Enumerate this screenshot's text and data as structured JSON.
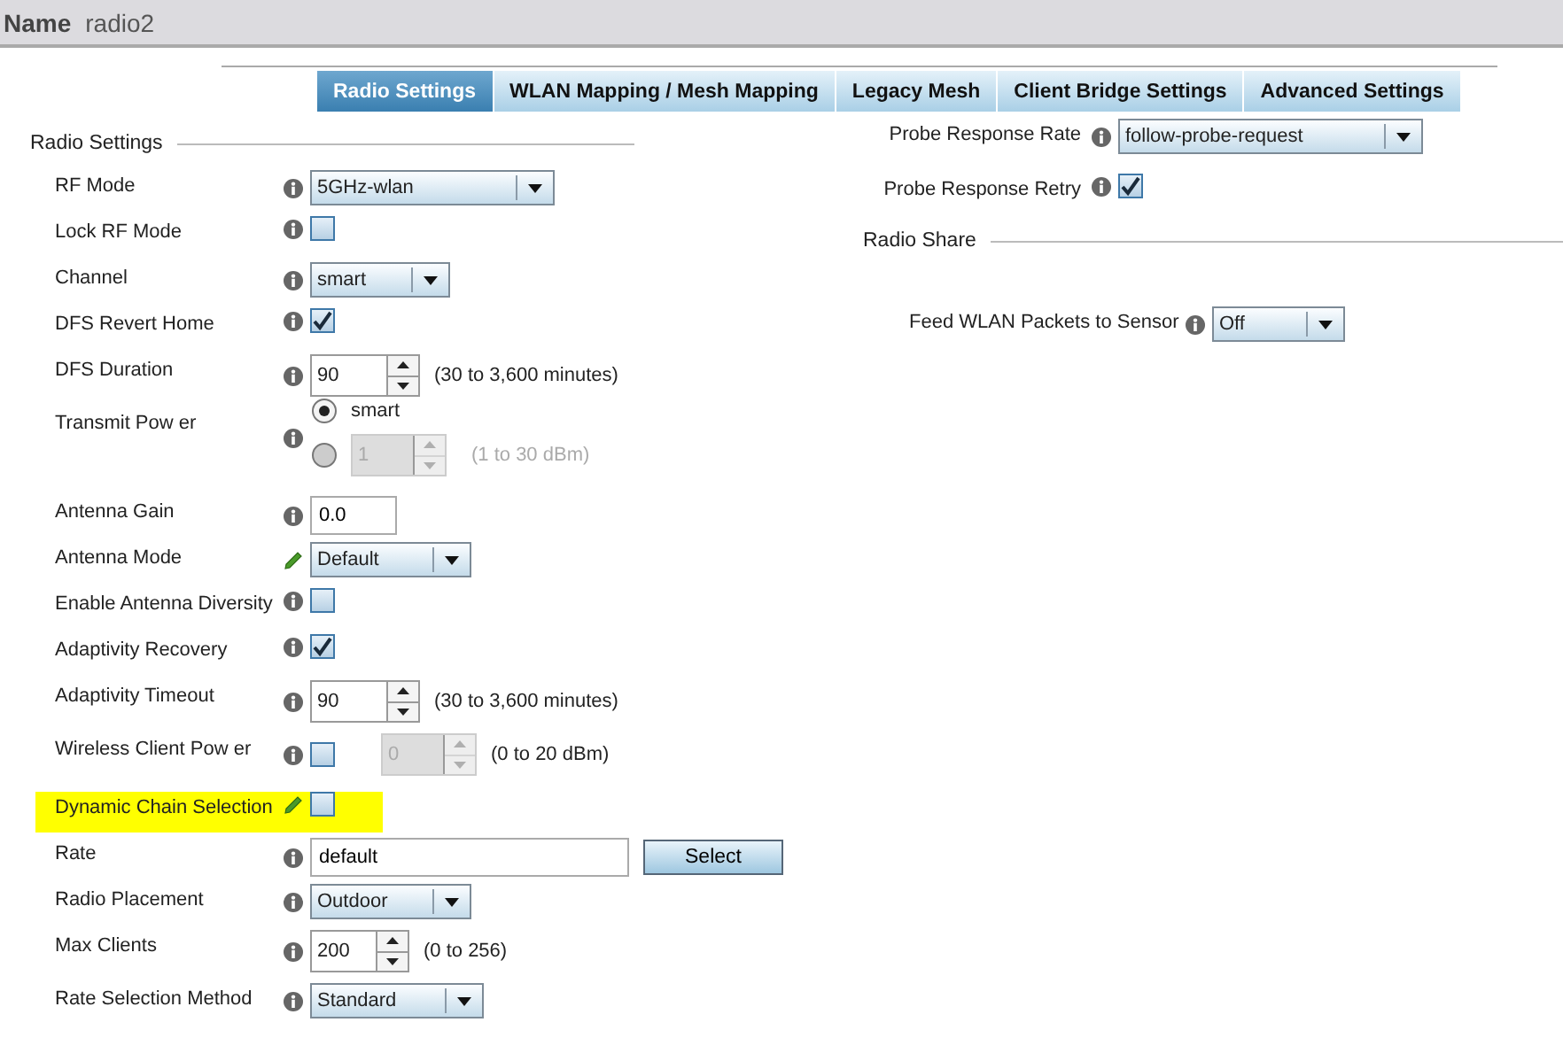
{
  "header": {
    "label": "Name",
    "value": "radio2"
  },
  "tabs": [
    {
      "label": "Radio Settings",
      "selected": true
    },
    {
      "label": "WLAN Mapping / Mesh Mapping",
      "selected": false
    },
    {
      "label": "Legacy Mesh",
      "selected": false
    },
    {
      "label": "Client Bridge Settings",
      "selected": false
    },
    {
      "label": "Advanced Settings",
      "selected": false
    }
  ],
  "radio_settings": {
    "title": "Radio Settings",
    "rows": [
      {
        "label": "RF Mode",
        "overridden": false,
        "kind": "select",
        "value": "5GHz-wlan"
      },
      {
        "label": "Lock RF Mode",
        "overridden": false,
        "kind": "checkbox",
        "checked": false
      },
      {
        "label": "Channel",
        "overridden": false,
        "kind": "select",
        "value": "smart"
      },
      {
        "label": "DFS Revert Home",
        "overridden": false,
        "kind": "checkbox",
        "checked": true
      },
      {
        "label": "DFS Duration",
        "overridden": false,
        "kind": "spinner",
        "value": "90",
        "hint": "(30 to 3,600 minutes)",
        "disabled": false
      },
      {
        "label": "Transmit Pow er",
        "overridden": false,
        "kind": "radios",
        "options": [
          {
            "kind": "radio",
            "label": "smart",
            "selected": true
          },
          {
            "kind": "radio-spinner",
            "value": "1",
            "hint": "(1 to 30 dBm)",
            "selected": false
          }
        ]
      },
      {
        "label": "Antenna Gain",
        "overridden": false,
        "kind": "text",
        "value": "0.0"
      },
      {
        "label": "Antenna Mode",
        "overridden": true,
        "kind": "select",
        "value": "Default"
      },
      {
        "label": "Enable Antenna Diversity",
        "overridden": false,
        "kind": "checkbox",
        "checked": false
      },
      {
        "label": "Adaptivity Recovery",
        "overridden": false,
        "kind": "checkbox",
        "checked": true
      },
      {
        "label": "Adaptivity Timeout",
        "overridden": false,
        "kind": "spinner",
        "value": "90",
        "hint": "(30 to 3,600 minutes)",
        "disabled": false
      },
      {
        "label": "Wireless Client Pow er",
        "overridden": false,
        "kind": "checkbox-spinner",
        "checked": false,
        "value": "0",
        "hint": "(0 to 20 dBm)",
        "disabled": true
      },
      {
        "label": "Dynamic Chain Selection",
        "overridden": true,
        "kind": "checkbox",
        "checked": false,
        "highlighted": true
      },
      {
        "label": "Rate",
        "overridden": false,
        "kind": "text-button",
        "value": "default",
        "button": "Select"
      },
      {
        "label": "Radio Placement",
        "overridden": false,
        "kind": "select",
        "value": "Outdoor"
      },
      {
        "label": "Max Clients",
        "overridden": false,
        "kind": "spinner",
        "value": "200",
        "hint": "(0 to 256)",
        "disabled": false
      },
      {
        "label": "Rate Selection Method",
        "overridden": false,
        "kind": "select",
        "value": "Standard"
      }
    ]
  },
  "probe_rows": [
    {
      "label": "Probe Response Rate",
      "overridden": false,
      "kind": "select",
      "value": "follow-probe-request"
    },
    {
      "label": "Probe Response Retry",
      "overridden": false,
      "kind": "checkbox",
      "checked": true
    }
  ],
  "radio_share": {
    "title": "Radio Share",
    "rows": [
      {
        "label": "Feed WLAN Packets to Sensor",
        "overridden": false,
        "kind": "select",
        "value": "Off"
      }
    ]
  }
}
